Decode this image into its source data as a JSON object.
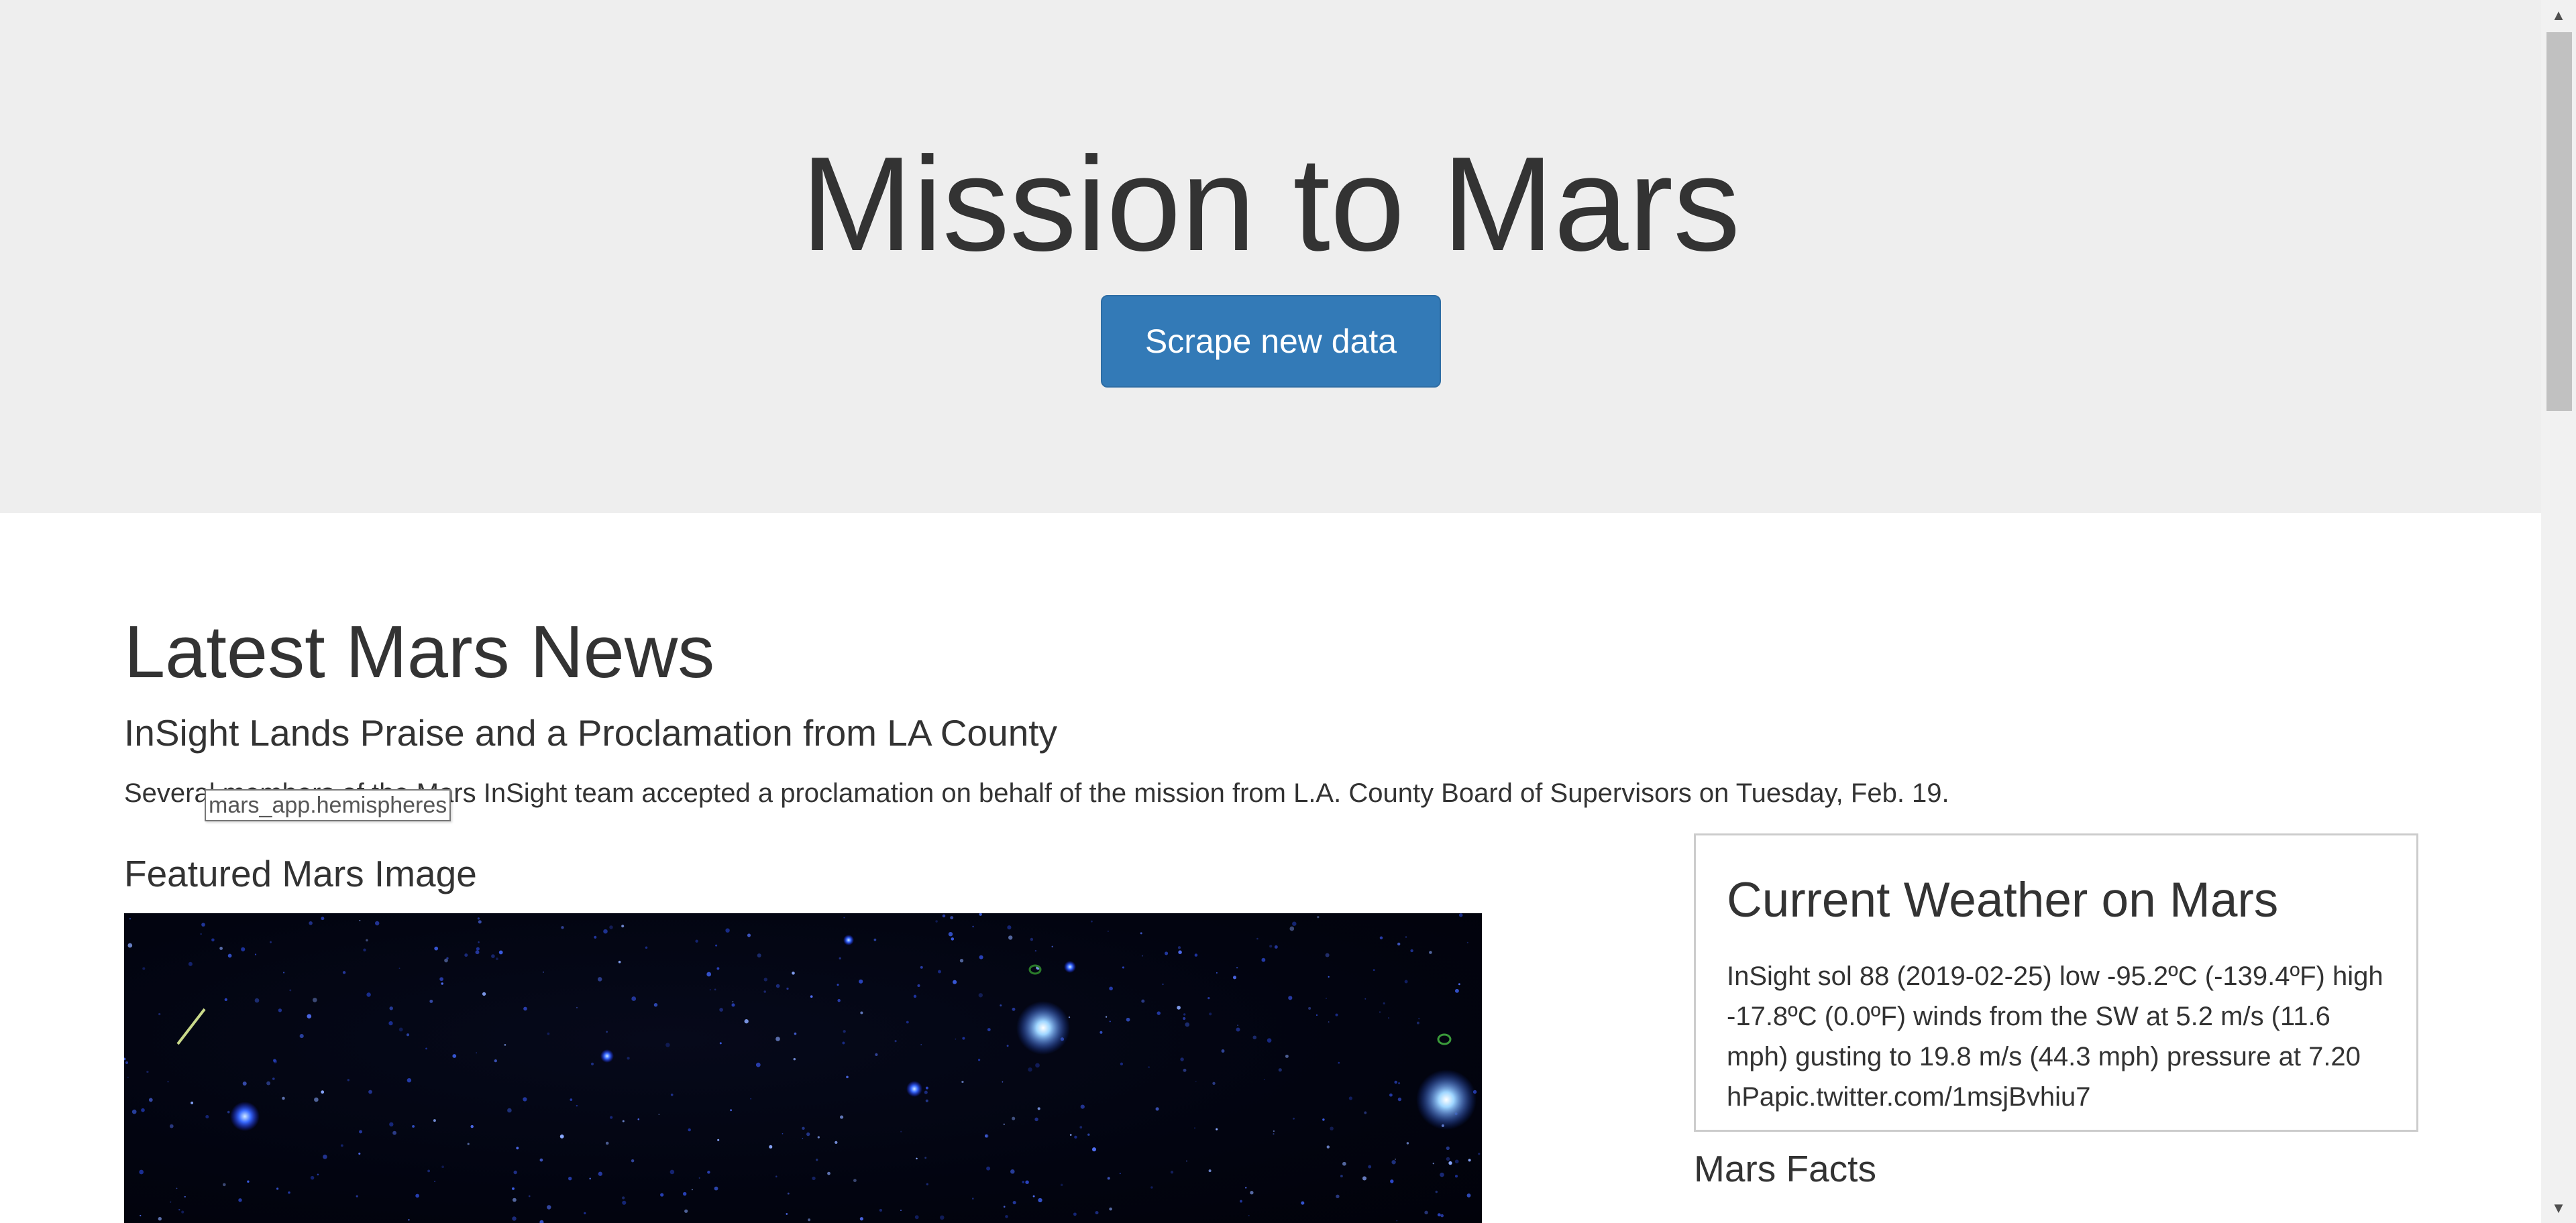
{
  "header": {
    "title": "Mission to Mars",
    "scrape_button_label": "Scrape new data"
  },
  "news": {
    "section_heading": "Latest Mars News",
    "title": "InSight Lands Praise and a Proclamation from LA County",
    "paragraph": "Several members of the Mars InSight team accepted a proclamation on behalf of the mission from L.A. County Board of Supervisors on Tuesday, Feb. 19."
  },
  "tooltip": {
    "text": "mars_app.hemispheres"
  },
  "featured_image": {
    "heading": "Featured Mars Image",
    "alt": "Star field image"
  },
  "weather": {
    "heading": "Current Weather on Mars",
    "text": "InSight sol 88 (2019-02-25) low -95.2ºC (-139.4ºF) high -17.8ºC (0.0ºF) winds from the SW at 5.2 m/s (11.6 mph) gusting to 19.8 m/s (44.3 mph) pressure at 7.20 hPapic.twitter.com/1msjBvhiu7"
  },
  "facts": {
    "heading": "Mars Facts"
  },
  "colors": {
    "jumbotron_bg": "#eeeeee",
    "button_primary": "#337ab7",
    "text": "#333333"
  }
}
